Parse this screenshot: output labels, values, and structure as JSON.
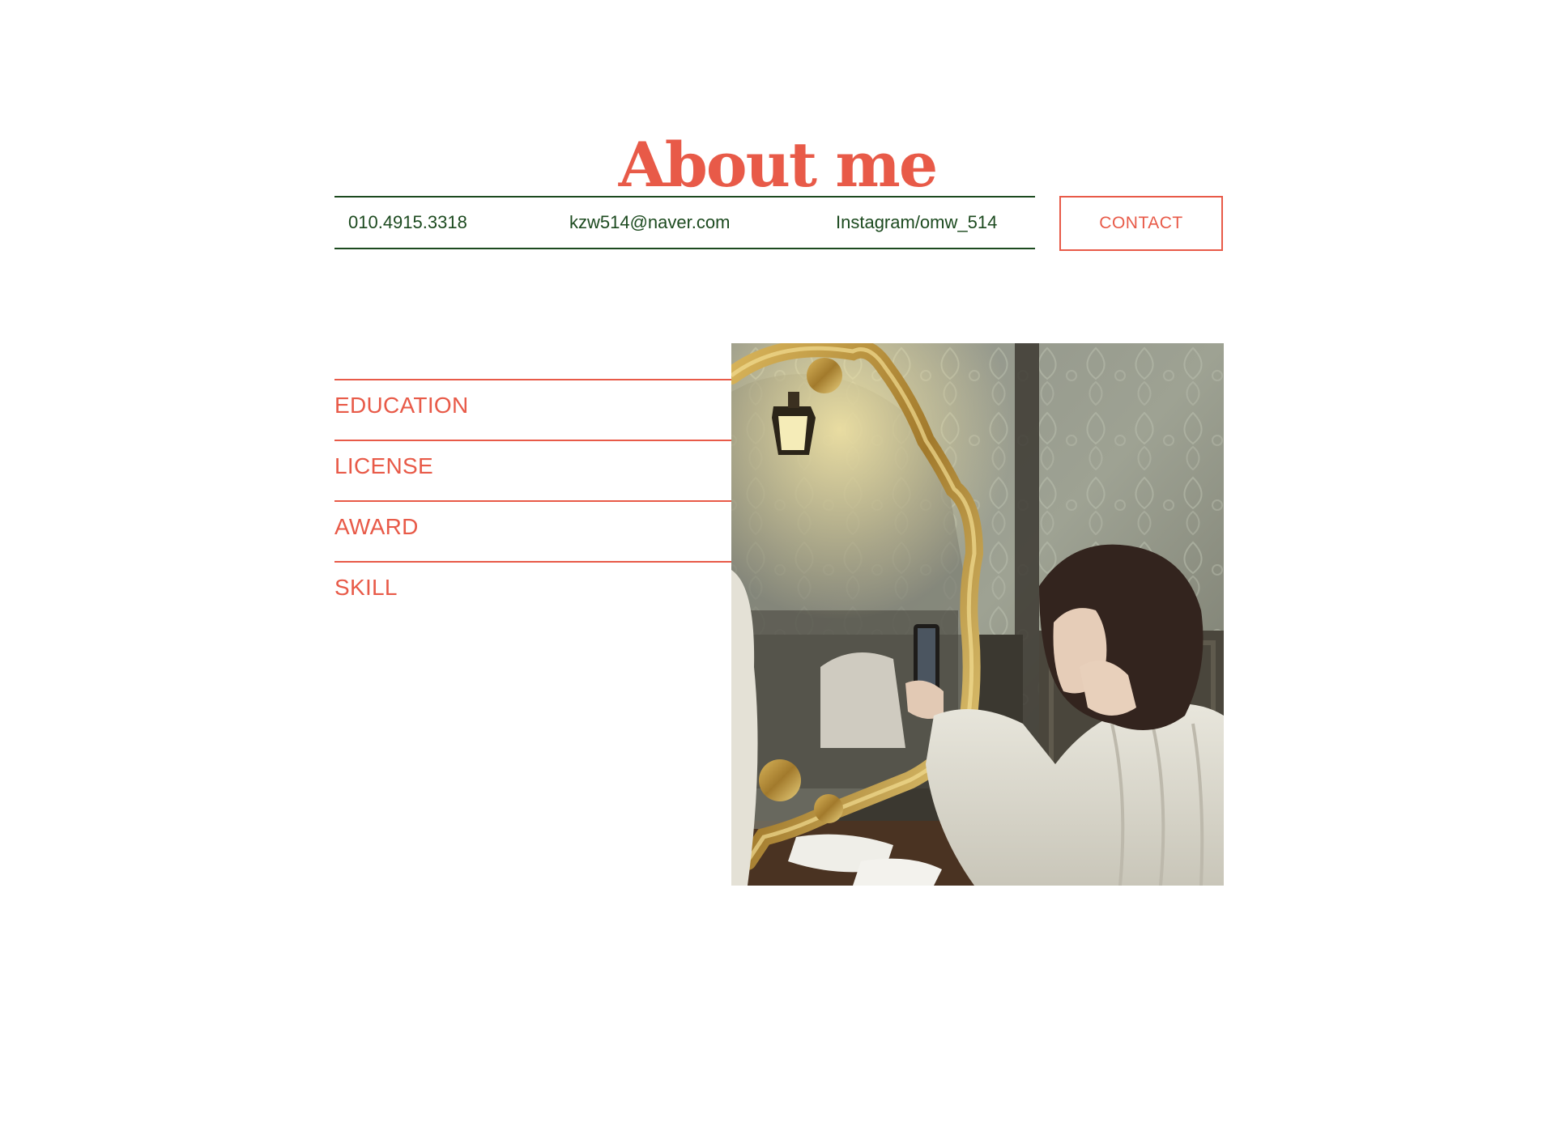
{
  "page": {
    "title": "About me"
  },
  "contact_bar": {
    "phone": "010.4915.3318",
    "email": "kzw514@naver.com",
    "instagram": "Instagram/omw_514",
    "button_label": "CONTACT"
  },
  "menu": {
    "items": [
      {
        "label": "EDUCATION"
      },
      {
        "label": "LICENSE"
      },
      {
        "label": "AWARD"
      },
      {
        "label": "SKILL"
      }
    ]
  },
  "photo": {
    "icon": "portrait-photo"
  },
  "colors": {
    "accent": "#e85a48",
    "contact_text": "#1c4a1f",
    "background": "#ffffff"
  }
}
